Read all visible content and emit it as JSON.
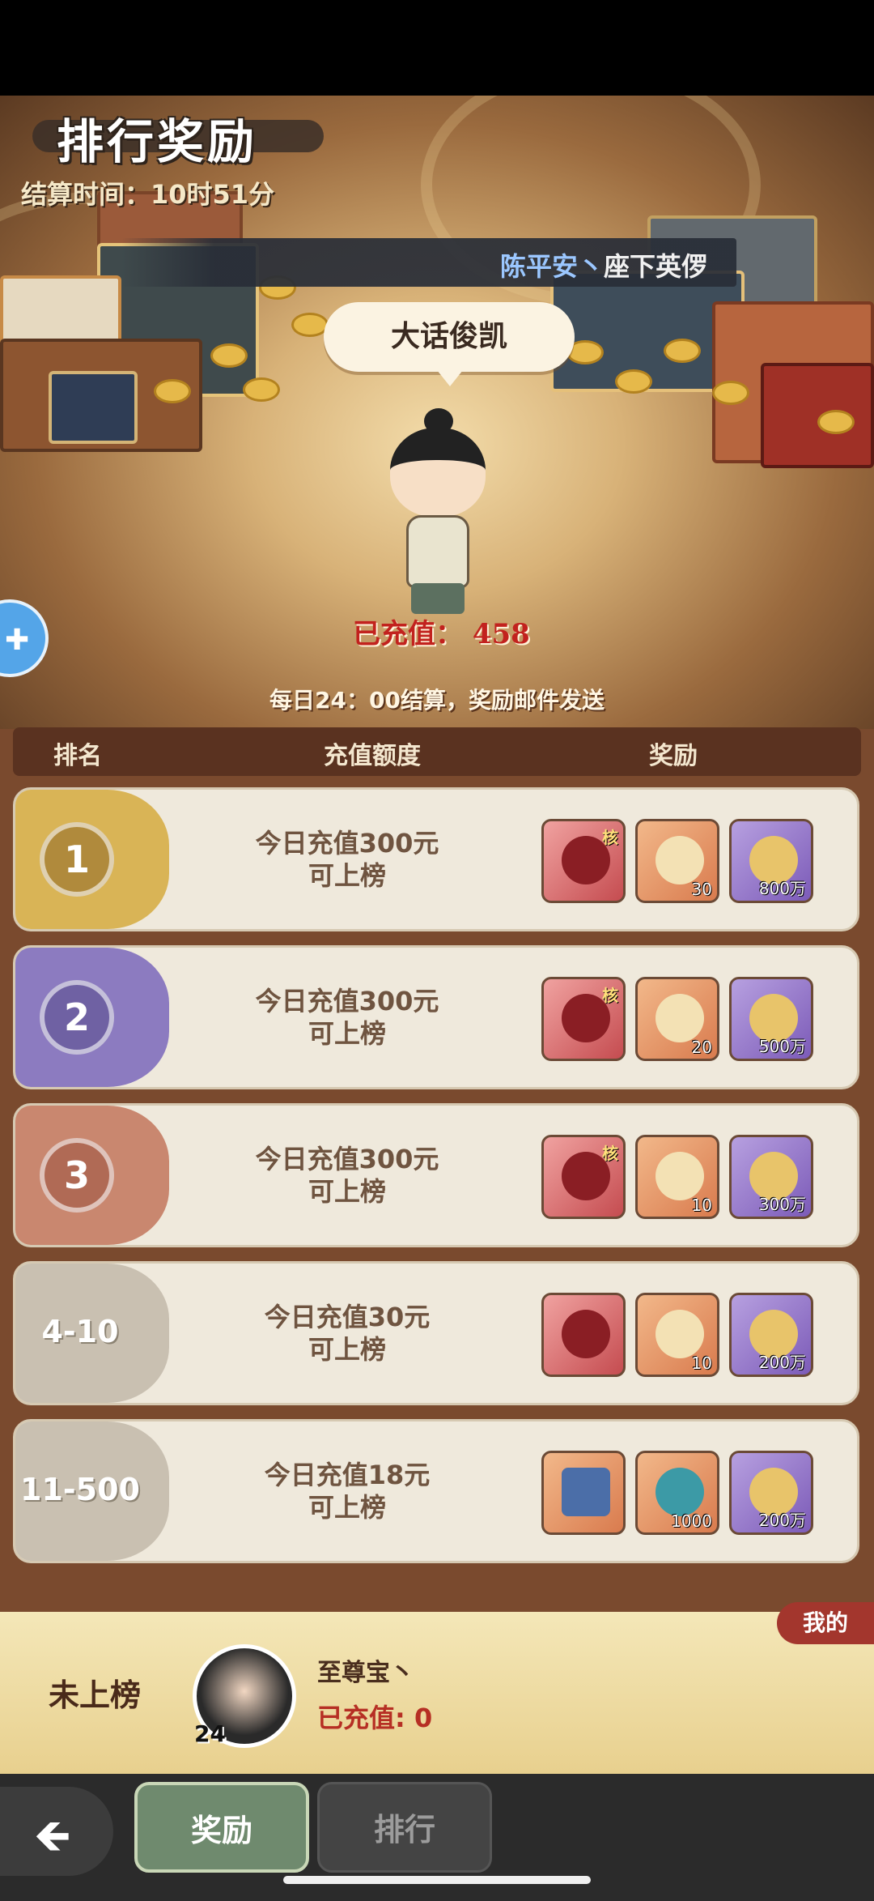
{
  "page": {
    "title": "排行奖励",
    "settle_time": "结算时间：10时51分",
    "marquee_name": "陈平安丶",
    "marquee_tail": "座下英㑩",
    "top_player_name": "大话俊凯",
    "top_player_recharged": "已充值： 458",
    "daily_hint": "每日24：00结算，奖励邮件发送"
  },
  "table": {
    "headers": [
      "排名",
      "充值额度",
      "奖励"
    ],
    "rows": [
      {
        "rank": "1",
        "line1": "今日充值300元",
        "line2": "可上榜",
        "items": [
          {
            "qty": "",
            "tag": "核"
          },
          {
            "qty": "30",
            "tag": ""
          },
          {
            "qty": "800万",
            "tag": ""
          }
        ]
      },
      {
        "rank": "2",
        "line1": "今日充值300元",
        "line2": "可上榜",
        "items": [
          {
            "qty": "",
            "tag": "核"
          },
          {
            "qty": "20",
            "tag": ""
          },
          {
            "qty": "500万",
            "tag": ""
          }
        ]
      },
      {
        "rank": "3",
        "line1": "今日充值300元",
        "line2": "可上榜",
        "items": [
          {
            "qty": "",
            "tag": "核"
          },
          {
            "qty": "10",
            "tag": ""
          },
          {
            "qty": "300万",
            "tag": ""
          }
        ]
      },
      {
        "rank": "4-10",
        "line1": "今日充值30元",
        "line2": "可上榜",
        "items": [
          {
            "qty": "",
            "tag": ""
          },
          {
            "qty": "10",
            "tag": ""
          },
          {
            "qty": "200万",
            "tag": ""
          }
        ]
      },
      {
        "rank": "11-500",
        "line1": "今日充值18元",
        "line2": "可上榜",
        "items": [
          {
            "qty": "",
            "tag": ""
          },
          {
            "qty": "1000",
            "tag": ""
          },
          {
            "qty": "200万",
            "tag": ""
          }
        ]
      }
    ]
  },
  "me": {
    "badge": "我的",
    "status": "未上榜",
    "name": "至尊宝丶",
    "recharged": "已充值: 0",
    "level": "24"
  },
  "nav": {
    "back_icon": "arrow-left-icon",
    "tab_reward": "奖励",
    "tab_rank": "排行"
  },
  "colors": {
    "gold": "#d9b456",
    "purple": "#8c7bc0",
    "bronze": "#c9876f",
    "gray": "#c9c0b1",
    "accent_red": "#c2221e"
  }
}
